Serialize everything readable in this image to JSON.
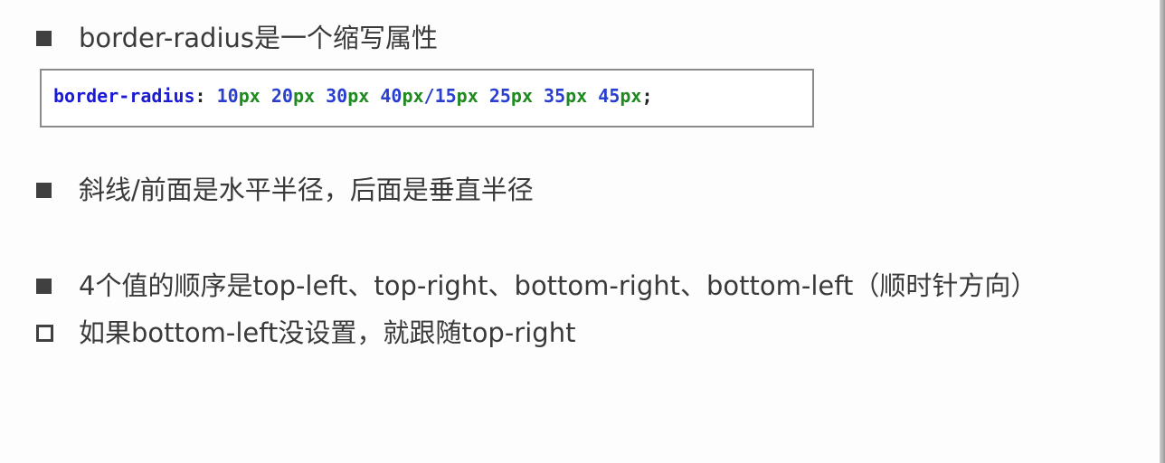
{
  "bullets": [
    {
      "text": "border-radius是一个缩写属性",
      "style": "filled"
    },
    {
      "text": "斜线/前面是水平半径，后面是垂直半径",
      "style": "filled"
    },
    {
      "text": "4个值的顺序是top-left、top-right、bottom-right、bottom-left（顺时针方向）",
      "style": "filled"
    },
    {
      "text": "如果bottom-left没设置，就跟随top-right",
      "style": "hollow"
    }
  ],
  "code": {
    "property": "border-radius",
    "colon": ":",
    "tokens": [
      {
        "num": "10",
        "unit": "px"
      },
      {
        "num": "20",
        "unit": "px"
      },
      {
        "num": "30",
        "unit": "px"
      },
      {
        "num": "40",
        "unit": "px"
      },
      {
        "sep": "/"
      },
      {
        "num": "15",
        "unit": "px"
      },
      {
        "num": "25",
        "unit": "px"
      },
      {
        "num": "35",
        "unit": "px"
      },
      {
        "num": "45",
        "unit": "px"
      }
    ],
    "semicolon": ";"
  },
  "colors": {
    "bullet": "#404040",
    "text": "#3a3a3a",
    "code_property": "#1a1ad6",
    "code_number": "#2a3fd0",
    "code_unit": "#1f8a1f",
    "box_border": "#8a8a8a"
  }
}
